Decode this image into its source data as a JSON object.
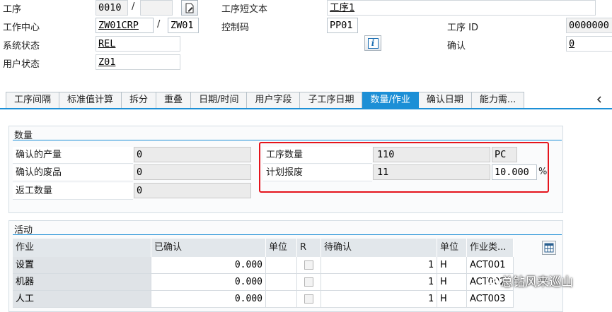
{
  "header": {
    "operation_label": "工序",
    "operation_value": "0010",
    "slash": "/",
    "op_short_text_label": "工序短文本",
    "op_short_text_value": "工序1",
    "work_center_label": "工作中心",
    "work_center_value": "ZW01CRP",
    "plant_value": "ZW01",
    "control_key_label": "控制码",
    "control_key_value": "PP01",
    "operation_id_label": "工序 ID",
    "operation_id_value": "0000000",
    "system_status_label": "系统状态",
    "system_status_value": "REL",
    "confirm_label": "确认",
    "confirm_value": "0",
    "user_status_label": "用户状态",
    "user_status_value": "Z01",
    "info_icon_glyph": "i"
  },
  "tabs": [
    {
      "label": "工序间隔"
    },
    {
      "label": "标准值计算"
    },
    {
      "label": "拆分"
    },
    {
      "label": "重叠"
    },
    {
      "label": "日期/时间"
    },
    {
      "label": "用户字段"
    },
    {
      "label": "子工序日期"
    },
    {
      "label": "数量/作业",
      "active": true
    },
    {
      "label": "确认日期"
    },
    {
      "label": "能力需..."
    }
  ],
  "quantity": {
    "title": "数量",
    "confirmed_yield_label": "确认的产量",
    "confirmed_yield_value": "0",
    "confirmed_scrap_label": "确认的废品",
    "confirmed_scrap_value": "0",
    "rework_label": "返工数量",
    "rework_value": "0",
    "op_qty_label": "工序数量",
    "op_qty_value": "110",
    "op_qty_unit": "PC",
    "planned_scrap_label": "计划报废",
    "planned_scrap_value": "11",
    "planned_scrap_pct": "10.000",
    "pct_sign": "%"
  },
  "activities": {
    "title": "活动",
    "columns": [
      "作业",
      "已确认",
      "单位",
      "R",
      "待确认",
      "单位",
      "作业类..."
    ],
    "rows": [
      {
        "activity": "设置",
        "confirmed": "0.000",
        "unit": "",
        "remaining": "1",
        "unit2": "H",
        "type": "ACT001"
      },
      {
        "activity": "机器",
        "confirmed": "0.000",
        "unit": "",
        "remaining": "1",
        "unit2": "H",
        "type": "ACT002"
      },
      {
        "activity": "人工",
        "confirmed": "0.000",
        "unit": "",
        "remaining": "1",
        "unit2": "H",
        "type": "ACT003"
      }
    ]
  },
  "watermark": "总钻风来巡山",
  "colors": {
    "accent": "#1c8fd6",
    "highlight": "#e5141c"
  }
}
